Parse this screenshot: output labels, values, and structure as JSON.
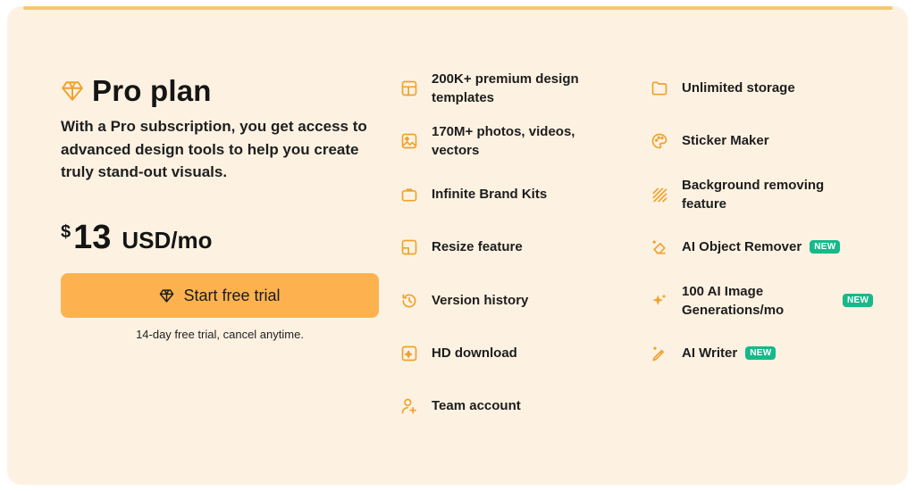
{
  "plan": {
    "title": "Pro plan",
    "description": "With a Pro subscription, you get access to advanced design tools to help you create truly stand-out visuals.",
    "price_currency": "$",
    "price_amount": "13",
    "price_period": "USD/mo",
    "cta_label": "Start free trial",
    "cta_note": "14-day free trial, cancel anytime."
  },
  "features_left": [
    {
      "label": "200K+ premium design templates",
      "icon": "templates-icon"
    },
    {
      "label": "170M+ photos, videos, vectors",
      "icon": "photo-icon"
    },
    {
      "label": "Infinite Brand Kits",
      "icon": "briefcase-icon"
    },
    {
      "label": "Resize feature",
      "icon": "resize-icon"
    },
    {
      "label": "Version history",
      "icon": "history-icon"
    },
    {
      "label": "HD download",
      "icon": "hd-download-icon"
    },
    {
      "label": "Team account",
      "icon": "add-user-icon"
    }
  ],
  "features_right": [
    {
      "label": "Unlimited storage",
      "icon": "folder-icon"
    },
    {
      "label": "Sticker Maker",
      "icon": "palette-icon"
    },
    {
      "label": "Background removing feature",
      "icon": "background-remove-icon"
    },
    {
      "label": "AI Object Remover",
      "icon": "eraser-icon",
      "badge": "NEW"
    },
    {
      "label": "100 AI Image Generations/mo",
      "icon": "sparkle-icon",
      "badge": "NEW"
    },
    {
      "label": "AI Writer",
      "icon": "pen-sparkle-icon",
      "badge": "NEW"
    }
  ],
  "colors": {
    "card_background": "#fdf2e2",
    "accent": "#fdb24f",
    "icon": "#f0a12c",
    "badge": "#17b98a"
  }
}
